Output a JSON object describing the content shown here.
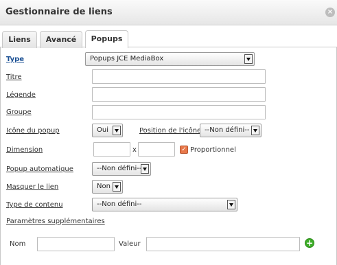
{
  "dialog": {
    "title": "Gestionnaire de liens",
    "close_label": "×"
  },
  "tabs": [
    {
      "label": "Liens"
    },
    {
      "label": "Avancé"
    },
    {
      "label": "Popups"
    }
  ],
  "active_tab": "Popups",
  "form": {
    "type_label": "Type",
    "type_value": "Popups JCE MediaBox",
    "titre_label": "Titre",
    "titre_value": "",
    "legende_label": "Légende",
    "legende_value": "",
    "groupe_label": "Groupe",
    "groupe_value": "",
    "icone_label": "Icône du popup",
    "icone_value": "Oui",
    "position_label": "Position de l'icône",
    "position_value": "--Non défini--",
    "dimension_label": "Dimension",
    "dimension_x": "x",
    "width_value": "",
    "height_value": "",
    "proportionnel_label": "Proportionnel",
    "proportionnel_checked": true,
    "auto_label": "Popup automatique",
    "auto_value": "--Non défini--",
    "masquer_label": "Masquer le lien",
    "masquer_value": "Non",
    "contenu_label": "Type de contenu",
    "contenu_value": "--Non défini--",
    "params_label": "Paramètres supplémentaires",
    "nom_label": "Nom",
    "nom_value": "",
    "valeur_label": "Valeur",
    "valeur_value": ""
  },
  "colors": {
    "accent_label": "#1a4f93",
    "checkbox": "#e8784a",
    "add_button": "#3fae2a"
  },
  "icons": {
    "close": "close-icon",
    "add": "plus-circle-icon",
    "dropdown": "chevron-down-icon",
    "check": "checkmark-icon"
  }
}
